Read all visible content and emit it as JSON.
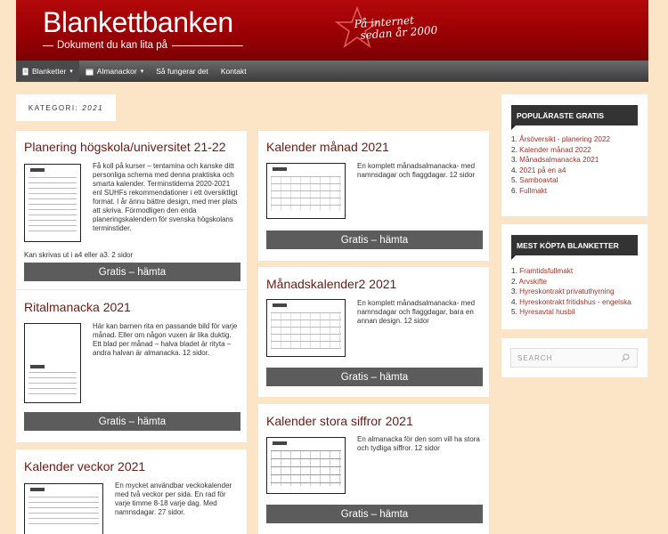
{
  "header": {
    "title": "Blankettbanken",
    "tagline": "Dokument du kan lita på",
    "slogan_line1": "På internet",
    "slogan_line2": "sedan år 2000"
  },
  "nav": {
    "items": [
      {
        "label": "Blanketter",
        "icon": "document-icon",
        "dropdown": true
      },
      {
        "label": "Almanackor",
        "icon": "calendar-icon",
        "dropdown": true
      },
      {
        "label": "Så fungerar det",
        "dropdown": false
      },
      {
        "label": "Kontakt",
        "dropdown": false
      }
    ]
  },
  "category": {
    "label": "KATEGORI:",
    "value": "2021"
  },
  "posts": [
    {
      "title": "Planering högskola/universitet 21-22",
      "text": "Få koll på kurser – tentamina och kanske ditt personliga schema med denna praktiska och smarta kalender. Terminstiderna 2020-2021 enl SUHFs rekommendationer i ett översiktligt format. I år ännu bättre design, med mer plats att skriva. Förmodligen den enda planeringskalendern för svenska högskolans terminstider.",
      "text_extra": "Kan skrivas ut i a4 eller a3. 2 sidor",
      "button": "Gratis – hämta"
    },
    {
      "title": "Ritalmanacka 2021",
      "text": "Här kan barnen rita en passande bild för varje månad. Eller om någon vuxen är lika duktig. Ett blad per månad – halva bladet är rityta – andra halvan är almanacka. 12 sidor.",
      "button": "Gratis – hämta"
    },
    {
      "title": "Kalender veckor 2021",
      "text": "En mycket användbar veckokalender med två veckor per sida. En rad för varje timme 8-18 varje dag. Med namnsdagar. 27 sidor."
    },
    {
      "title": "Kalender månad 2021",
      "text": "En komplett månadsalmanacka- med namnsdagar och flaggdagar. 12 sidor",
      "button": "Gratis – hämta"
    },
    {
      "title": "Månadskalender2 2021",
      "text": "En komplett månadsalmanacka- med namnsdagar och flaggdagar, bara en annan design. 12 sidor",
      "button": "Gratis – hämta"
    },
    {
      "title": "Kalender stora siffror 2021",
      "text": "En almanacka för den som vill ha stora och tydliga siffror. 12 sidor",
      "button": "Gratis – hämta"
    }
  ],
  "sidebar": {
    "popular_title": "POPULÄRASTE GRATIS",
    "popular": [
      {
        "num": "1.",
        "label": "Årsöversikt - planering 2022"
      },
      {
        "num": "2.",
        "label": "Kalender månad 2022"
      },
      {
        "num": "3.",
        "label": "Månadsalmanacka 2021"
      },
      {
        "num": "4.",
        "label": "2021 på en a4"
      },
      {
        "num": "5.",
        "label": "Samboavtal"
      },
      {
        "num": "6.",
        "label": "Fullmakt"
      }
    ],
    "bought_title": "MEST KÖPTA BLANKETTER",
    "bought": [
      {
        "num": "1.",
        "label": "Framtidsfullmakt"
      },
      {
        "num": "2.",
        "label": "Arvskifte"
      },
      {
        "num": "3.",
        "label": "Hyreskontrakt privatuthyrning"
      },
      {
        "num": "4.",
        "label": "Hyreskontrakt fritidshus - engelska"
      },
      {
        "num": "5.",
        "label": "Hyresavtal husbil"
      }
    ],
    "search_placeholder": "SEARCH"
  },
  "colors": {
    "background": "#fbe5c6",
    "header_red": "#9a0004",
    "nav_gray": "#4a4a4a",
    "button_gray": "#5c5c5c",
    "title_brown": "#6b1a14",
    "link_red": "#a0332a"
  }
}
